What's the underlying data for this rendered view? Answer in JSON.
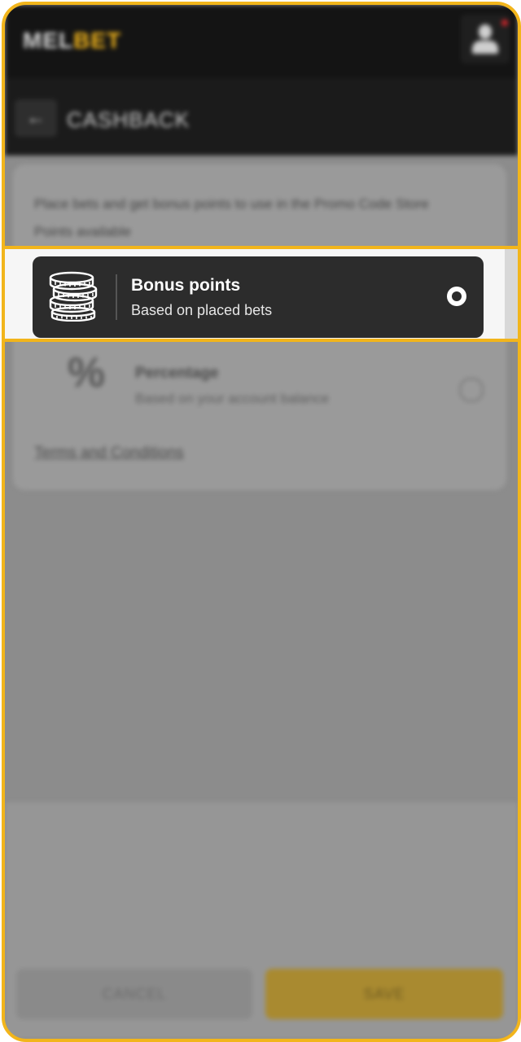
{
  "brand": {
    "logo_part1": "MEL",
    "logo_part2": "BET",
    "accent": "#f2b51b"
  },
  "header": {
    "back_label": "←",
    "title": "CASHBACK"
  },
  "card": {
    "description": "Place bets and get bonus points to use in the Promo Code Store",
    "points_label": "Points available"
  },
  "options": {
    "bonus": {
      "title": "Bonus points",
      "subtitle": "Based on placed bets",
      "selected": true
    },
    "percentage": {
      "icon_text": "%",
      "title": "Percentage",
      "subtitle": "Based on your account balance",
      "selected": false
    }
  },
  "terms_label": "Terms and Conditions",
  "footer": {
    "cancel_label": "CANCEL",
    "save_label": "SAVE"
  }
}
